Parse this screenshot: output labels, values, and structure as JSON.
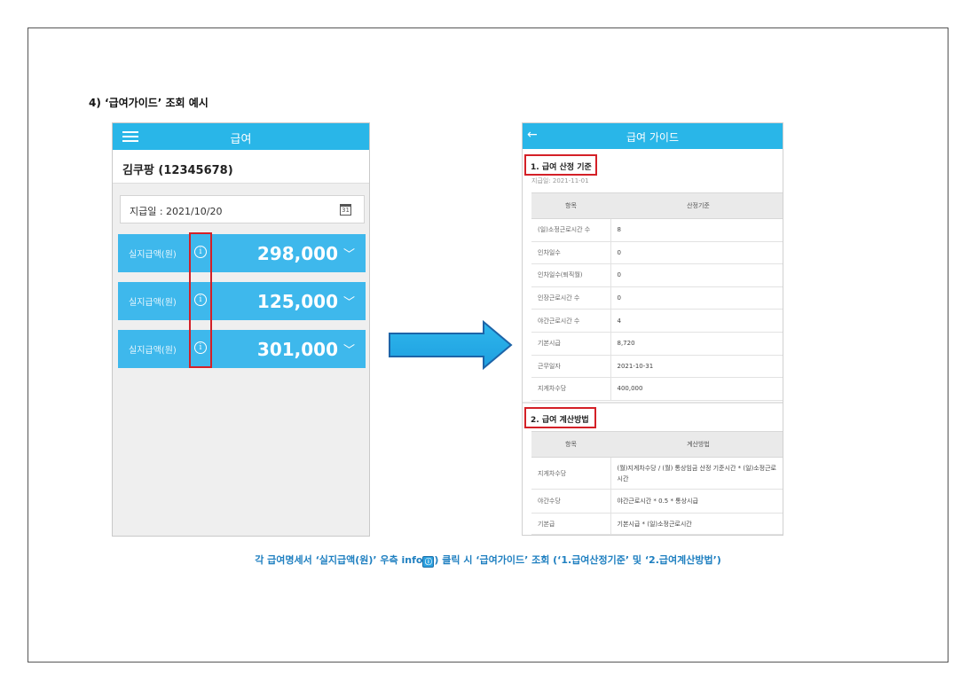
{
  "heading": "4)  ‘급여가이드’ 조회  예시",
  "left_app": {
    "title": "급여",
    "user": "김쿠팡 (12345678)",
    "pay_date": "지급일 : 2021/10/20",
    "calendar_glyph": "31",
    "rows": [
      {
        "label": "실지급액(원)",
        "amount": "298,000"
      },
      {
        "label": "실지급액(원)",
        "amount": "125,000"
      },
      {
        "label": "실지급액(원)",
        "amount": "301,000"
      }
    ]
  },
  "right_app": {
    "title": "급여 가이드",
    "section1": {
      "title": "1. 급여 산정 기준",
      "date": "지급일: 2021-11-01",
      "headers": [
        "항목",
        "산정기준"
      ],
      "rows": [
        [
          "(일)소정근로시간 수",
          "8"
        ],
        [
          "인차일수",
          "0"
        ],
        [
          "인차일수(퇴직월)",
          "0"
        ],
        [
          "인장근로시간 수",
          "0"
        ],
        [
          "야간근로시간 수",
          "4"
        ],
        [
          "기본시급",
          "8,720"
        ],
        [
          "근무일자",
          "2021-10-31"
        ],
        [
          "지게차수당",
          "400,000"
        ]
      ]
    },
    "section2": {
      "title": "2. 급여 계산방법",
      "headers": [
        "항목",
        "계산방법"
      ],
      "rows": [
        [
          "지게차수당",
          "(월)지게차수당 / (월) 통상임금 산정 기준시간 * (일)소정근로시간"
        ],
        [
          "야간수당",
          "야간근로시간 * 0.5 * 통상시급"
        ],
        [
          "기본급",
          "기본시급 * (일)소정근로시간"
        ]
      ]
    }
  },
  "caption": {
    "before": "각  급여명세서  ‘실지급액(원)’  우측  info",
    "icon_glyph": "ⓘ",
    "after": ")  클릭  시  ‘급여가이드’  조회  (‘1.급여산정기준’  및  ‘2.급여계산방법’)"
  },
  "colors": {
    "app_bar": "#29b6e8",
    "pay_row": "#3eb8ec",
    "highlight": "#d42027",
    "caption": "#1e7fc0"
  }
}
